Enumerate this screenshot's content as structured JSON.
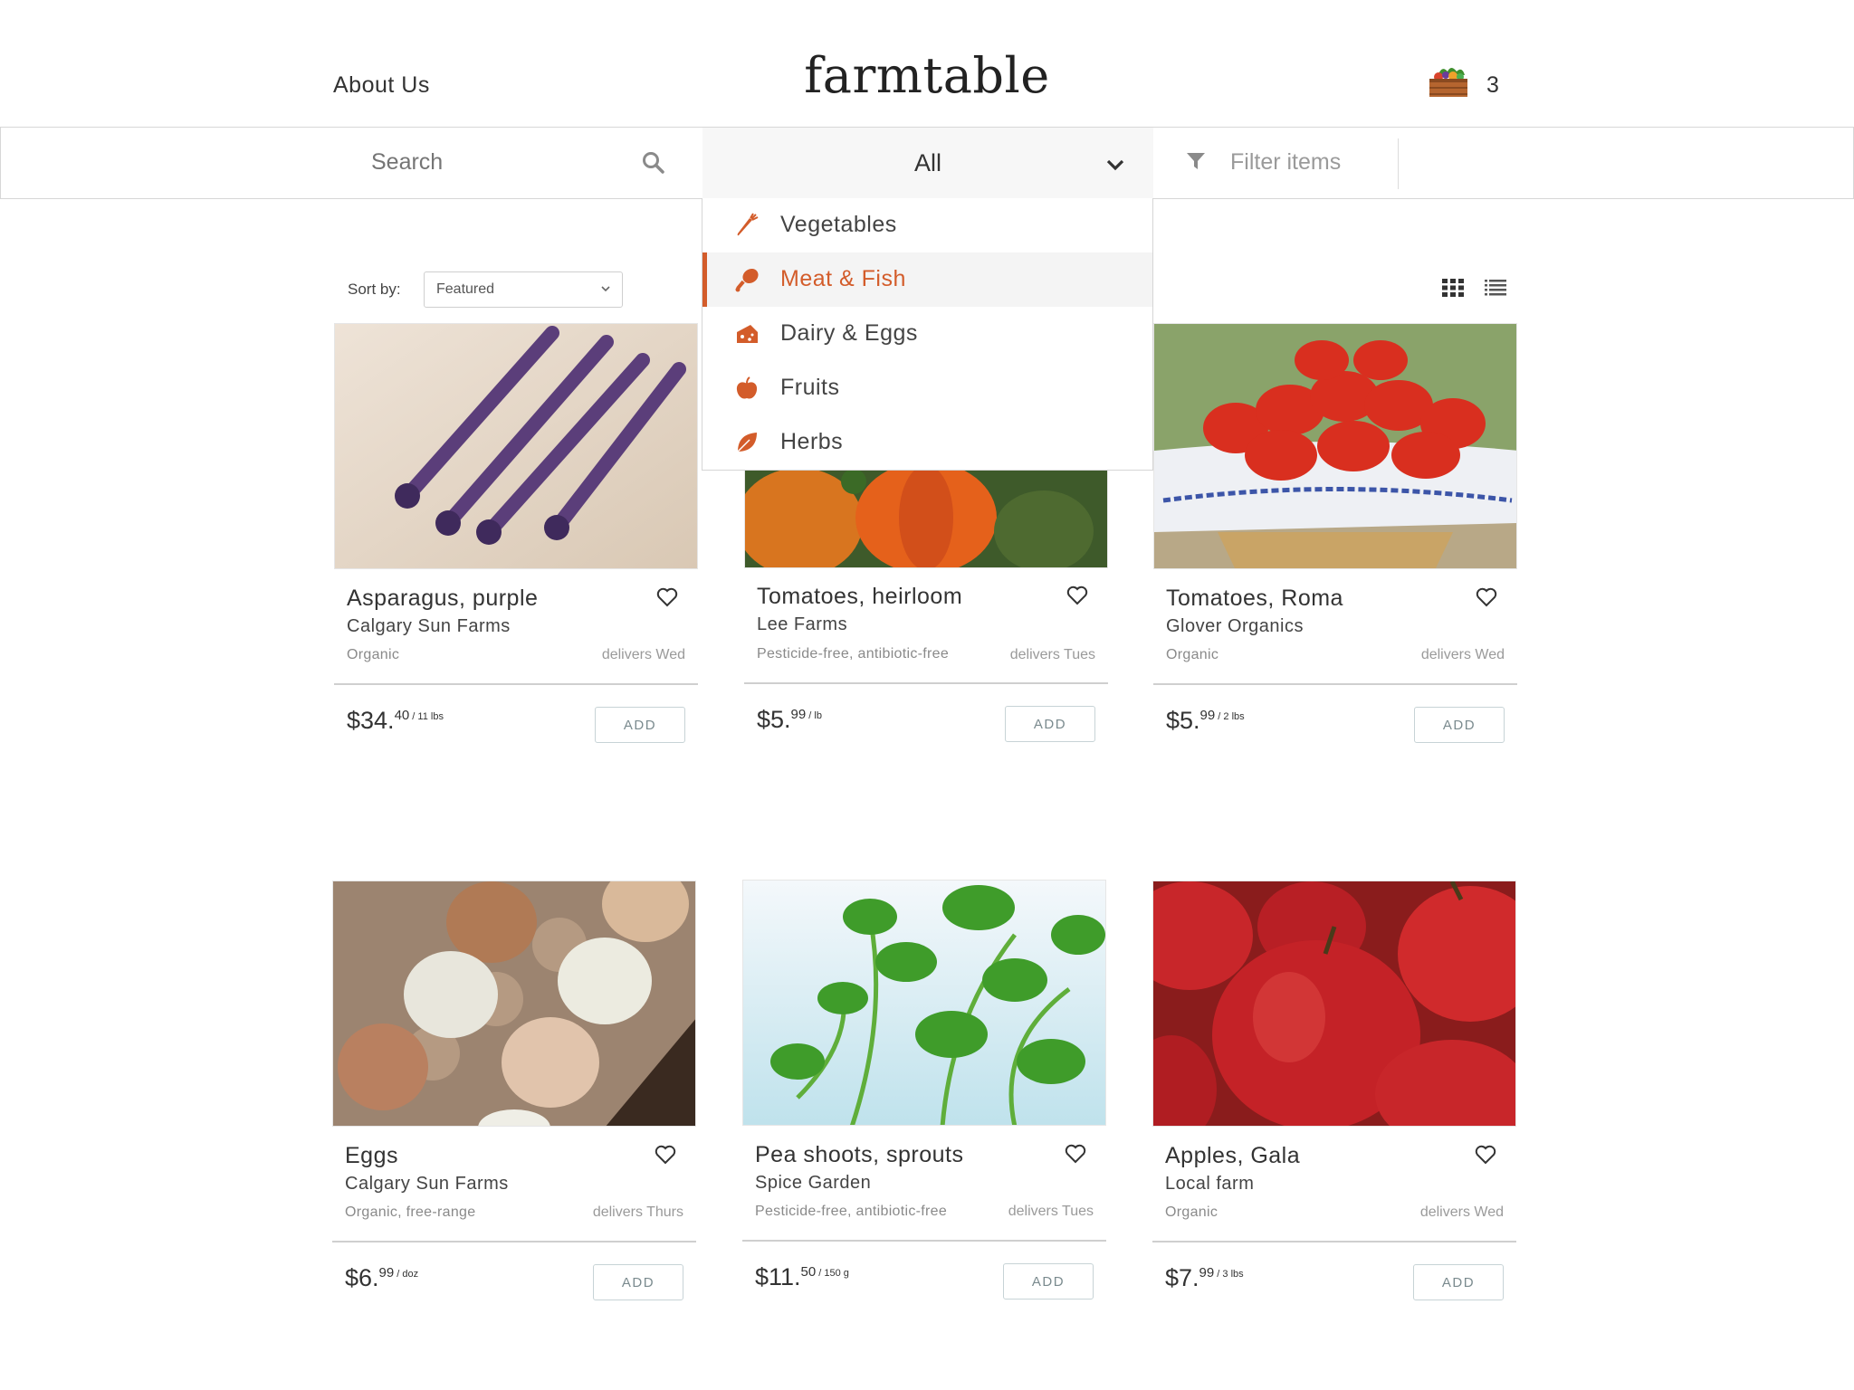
{
  "header": {
    "about_label": "About Us",
    "logo": "farmtable",
    "cart_count": "3",
    "cart_icon": "produce-crate-icon"
  },
  "toolbar": {
    "search_placeholder": "Search",
    "category_selected": "All",
    "filter_label": "Filter items"
  },
  "dropdown": {
    "items": [
      {
        "label": "Vegetables",
        "icon": "carrot-icon",
        "active": false
      },
      {
        "label": "Meat & Fish",
        "icon": "drumstick-icon",
        "active": true
      },
      {
        "label": "Dairy & Eggs",
        "icon": "cheese-icon",
        "active": false
      },
      {
        "label": "Fruits",
        "icon": "apple-icon",
        "active": false
      },
      {
        "label": "Herbs",
        "icon": "leaf-icon",
        "active": false
      }
    ]
  },
  "sort": {
    "label": "Sort by:",
    "value": "Featured"
  },
  "colors": {
    "accent": "#d35c2a",
    "text": "#333333",
    "muted": "#9a9a9a",
    "add_border": "#c7d3d6"
  },
  "products": [
    {
      "name": "Asparagus, purple",
      "farm": "Calgary Sun Farms",
      "tags": "Organic",
      "delivers": "delivers Wed",
      "price_whole": "$34.",
      "price_cents": "40",
      "price_unit": " / 11 lbs",
      "add_label": "ADD",
      "image": "purple-asparagus-photo"
    },
    {
      "name": "Tomatoes, heirloom",
      "farm": "Lee Farms",
      "tags": "Pesticide-free, antibiotic-free",
      "delivers": "delivers Tues",
      "price_whole": "$5.",
      "price_cents": "99",
      "price_unit": " / lb",
      "add_label": "ADD",
      "image": "heirloom-tomatoes-photo"
    },
    {
      "name": "Tomatoes, Roma",
      "farm": "Glover Organics",
      "tags": "Organic",
      "delivers": "delivers Wed",
      "price_whole": "$5.",
      "price_cents": "99",
      "price_unit": " / 2 lbs",
      "add_label": "ADD",
      "image": "roma-tomatoes-photo"
    },
    {
      "name": "Eggs",
      "farm": "Calgary Sun Farms",
      "tags": "Organic, free-range",
      "delivers": "delivers Thurs",
      "price_whole": "$6.",
      "price_cents": "99",
      "price_unit": " / doz",
      "add_label": "ADD",
      "image": "eggs-carton-photo"
    },
    {
      "name": "Pea shoots, sprouts",
      "farm": "Spice Garden",
      "tags": "Pesticide-free, antibiotic-free",
      "delivers": "delivers Tues",
      "price_whole": "$11.",
      "price_cents": "50",
      "price_unit": " / 150 g",
      "add_label": "ADD",
      "image": "pea-shoots-photo"
    },
    {
      "name": "Apples, Gala",
      "farm": "Local farm",
      "tags": "Organic",
      "delivers": "delivers Wed",
      "price_whole": "$7.",
      "price_cents": "99",
      "price_unit": " / 3 lbs",
      "add_label": "ADD",
      "image": "gala-apples-photo"
    }
  ]
}
